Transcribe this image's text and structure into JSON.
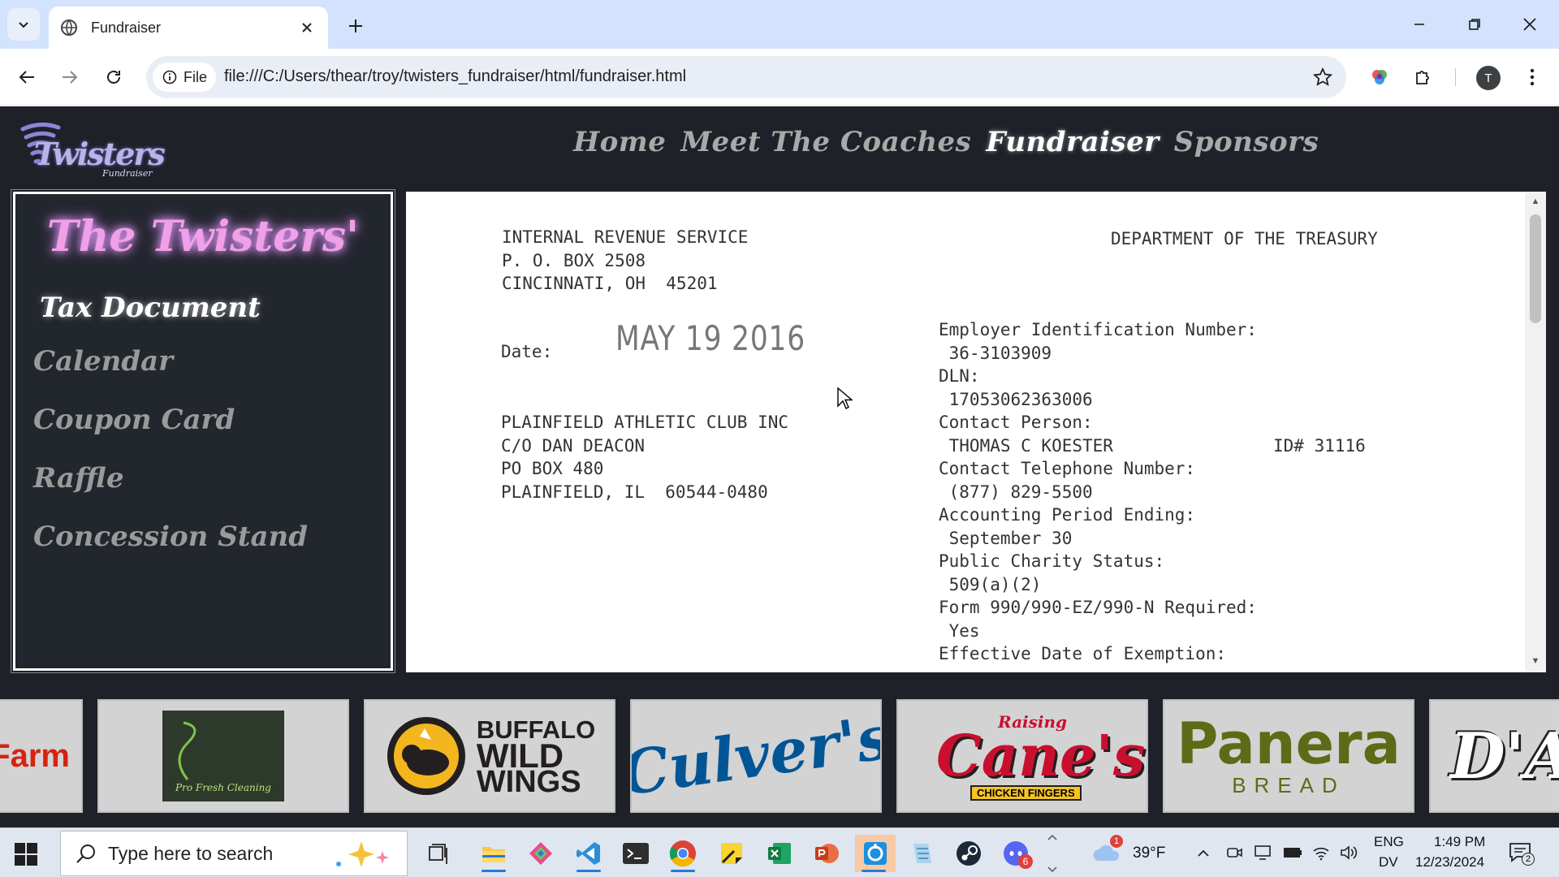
{
  "browser": {
    "tab_title": "Fundraiser",
    "url": "file:///C:/Users/thear/troy/twisters_fundraiser/html/fundraiser.html",
    "chip_label": "File",
    "profile_initial": "T"
  },
  "site": {
    "logo_text": "Twisters",
    "logo_sub": "Fundraiser",
    "nav": [
      "Home",
      "Meet The Coaches",
      "Fundraiser",
      "Sponsors"
    ],
    "active_nav": "Fundraiser"
  },
  "sidebar": {
    "heading": "The Twisters'",
    "items": [
      "Tax Document",
      "Calendar",
      "Coupon Card",
      "Raffle",
      "Concession Stand"
    ],
    "active_item": "Tax Document"
  },
  "document": {
    "sender_lines": [
      "INTERNAL REVENUE SERVICE",
      "P. O. BOX 2508",
      "CINCINNATI, OH  45201"
    ],
    "department": "DEPARTMENT OF THE TREASURY",
    "date_label": "Date:",
    "date_stamp": "MAY 19 2016",
    "recipient_lines": [
      "PLAINFIELD ATHLETIC CLUB INC",
      "C/O DAN DEACON",
      "PO BOX 480",
      "PLAINFIELD, IL  60544-0480"
    ],
    "fields": [
      "Employer Identification Number:",
      " 36-3103909",
      "DLN:",
      " 17053062363006",
      "Contact Person:",
      " THOMAS C KOESTER",
      "Contact Telephone Number:",
      " (877) 829-5500",
      "Accounting Period Ending:",
      " September 30",
      "Public Charity Status:",
      " 509(a)(2)",
      "Form 990/990-EZ/990-N Required:",
      " Yes",
      "Effective Date of Exemption:"
    ],
    "contact_id": "ID# 31116"
  },
  "sponsors": [
    "State Farm",
    "Pro Fresh Cleaning",
    "Buffalo Wild Wings",
    "Culver's",
    "Raising Cane's Chicken Fingers",
    "Panera Bread",
    "D'A"
  ],
  "sponsor_text": {
    "farm": "Farm",
    "profresh": "Pro Fresh Cleaning",
    "bww_1": "BUFFALO",
    "bww_2": "WILD",
    "bww_3": "WINGS",
    "culvers": "Culver's",
    "canes_top": "Raising",
    "canes": "Cane's",
    "canes_sub": "CHICKEN FINGERS",
    "panera": "Panera",
    "panera_sub": "BREAD",
    "last": "D'A"
  },
  "taskbar": {
    "search_placeholder": "Type here to search",
    "weather": "39°F",
    "weather_badge": "1",
    "lang_top": "ENG",
    "lang_bottom": "DV",
    "time": "1:49 PM",
    "date": "12/23/2024",
    "notification_count": "2",
    "discord_badge": "6"
  }
}
